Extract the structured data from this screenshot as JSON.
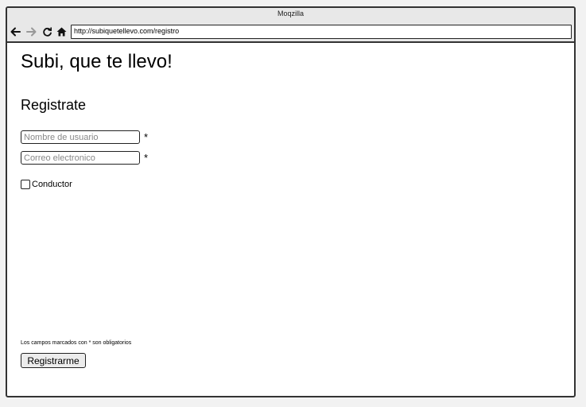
{
  "browser": {
    "title": "Moqzilla",
    "url": "http://subiquetellevo.com/registro",
    "icons": [
      "back-arrow-icon",
      "forward-arrow-icon",
      "reload-icon",
      "home-icon"
    ]
  },
  "page": {
    "site_title": "Subi, que te llevo!",
    "section_title": "Registrate",
    "fields": {
      "username_placeholder": "Nombre de usuario",
      "email_placeholder": "Correo electronico",
      "required_marker": "*"
    },
    "checkbox": {
      "label": "Conductor",
      "checked": false
    },
    "footnote": "Los campos marcados con * son obligatorios",
    "submit_label": "Registrarme"
  }
}
